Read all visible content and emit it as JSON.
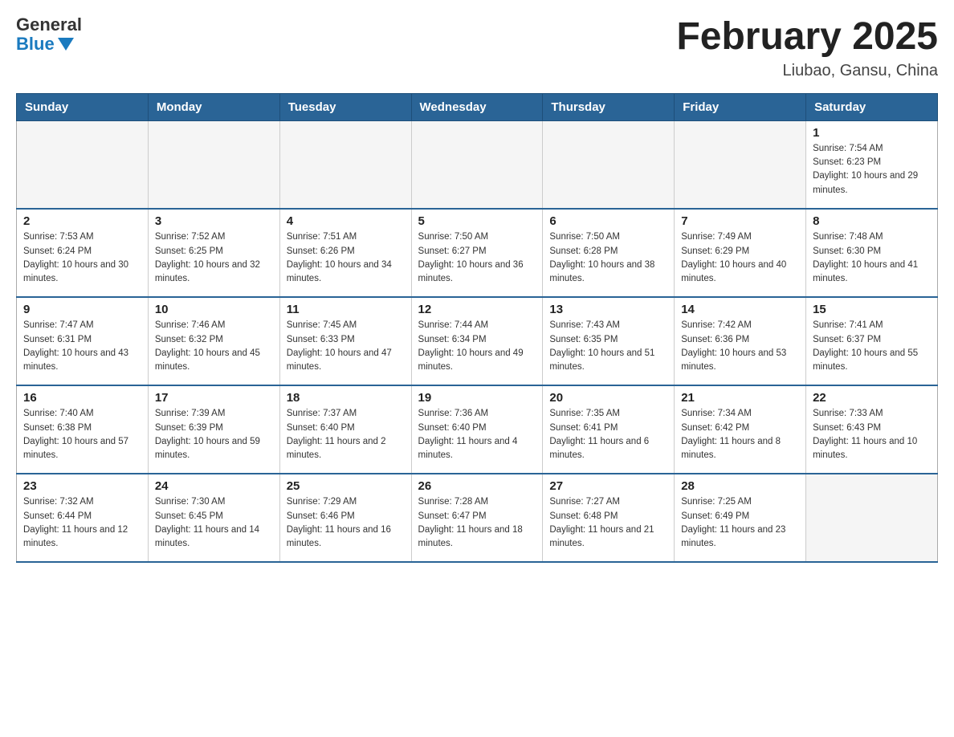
{
  "logo": {
    "general": "General",
    "blue": "Blue"
  },
  "title": "February 2025",
  "subtitle": "Liubao, Gansu, China",
  "days_header": [
    "Sunday",
    "Monday",
    "Tuesday",
    "Wednesday",
    "Thursday",
    "Friday",
    "Saturday"
  ],
  "weeks": [
    [
      {
        "day": "",
        "sunrise": "",
        "sunset": "",
        "daylight": ""
      },
      {
        "day": "",
        "sunrise": "",
        "sunset": "",
        "daylight": ""
      },
      {
        "day": "",
        "sunrise": "",
        "sunset": "",
        "daylight": ""
      },
      {
        "day": "",
        "sunrise": "",
        "sunset": "",
        "daylight": ""
      },
      {
        "day": "",
        "sunrise": "",
        "sunset": "",
        "daylight": ""
      },
      {
        "day": "",
        "sunrise": "",
        "sunset": "",
        "daylight": ""
      },
      {
        "day": "1",
        "sunrise": "Sunrise: 7:54 AM",
        "sunset": "Sunset: 6:23 PM",
        "daylight": "Daylight: 10 hours and 29 minutes."
      }
    ],
    [
      {
        "day": "2",
        "sunrise": "Sunrise: 7:53 AM",
        "sunset": "Sunset: 6:24 PM",
        "daylight": "Daylight: 10 hours and 30 minutes."
      },
      {
        "day": "3",
        "sunrise": "Sunrise: 7:52 AM",
        "sunset": "Sunset: 6:25 PM",
        "daylight": "Daylight: 10 hours and 32 minutes."
      },
      {
        "day": "4",
        "sunrise": "Sunrise: 7:51 AM",
        "sunset": "Sunset: 6:26 PM",
        "daylight": "Daylight: 10 hours and 34 minutes."
      },
      {
        "day": "5",
        "sunrise": "Sunrise: 7:50 AM",
        "sunset": "Sunset: 6:27 PM",
        "daylight": "Daylight: 10 hours and 36 minutes."
      },
      {
        "day": "6",
        "sunrise": "Sunrise: 7:50 AM",
        "sunset": "Sunset: 6:28 PM",
        "daylight": "Daylight: 10 hours and 38 minutes."
      },
      {
        "day": "7",
        "sunrise": "Sunrise: 7:49 AM",
        "sunset": "Sunset: 6:29 PM",
        "daylight": "Daylight: 10 hours and 40 minutes."
      },
      {
        "day": "8",
        "sunrise": "Sunrise: 7:48 AM",
        "sunset": "Sunset: 6:30 PM",
        "daylight": "Daylight: 10 hours and 41 minutes."
      }
    ],
    [
      {
        "day": "9",
        "sunrise": "Sunrise: 7:47 AM",
        "sunset": "Sunset: 6:31 PM",
        "daylight": "Daylight: 10 hours and 43 minutes."
      },
      {
        "day": "10",
        "sunrise": "Sunrise: 7:46 AM",
        "sunset": "Sunset: 6:32 PM",
        "daylight": "Daylight: 10 hours and 45 minutes."
      },
      {
        "day": "11",
        "sunrise": "Sunrise: 7:45 AM",
        "sunset": "Sunset: 6:33 PM",
        "daylight": "Daylight: 10 hours and 47 minutes."
      },
      {
        "day": "12",
        "sunrise": "Sunrise: 7:44 AM",
        "sunset": "Sunset: 6:34 PM",
        "daylight": "Daylight: 10 hours and 49 minutes."
      },
      {
        "day": "13",
        "sunrise": "Sunrise: 7:43 AM",
        "sunset": "Sunset: 6:35 PM",
        "daylight": "Daylight: 10 hours and 51 minutes."
      },
      {
        "day": "14",
        "sunrise": "Sunrise: 7:42 AM",
        "sunset": "Sunset: 6:36 PM",
        "daylight": "Daylight: 10 hours and 53 minutes."
      },
      {
        "day": "15",
        "sunrise": "Sunrise: 7:41 AM",
        "sunset": "Sunset: 6:37 PM",
        "daylight": "Daylight: 10 hours and 55 minutes."
      }
    ],
    [
      {
        "day": "16",
        "sunrise": "Sunrise: 7:40 AM",
        "sunset": "Sunset: 6:38 PM",
        "daylight": "Daylight: 10 hours and 57 minutes."
      },
      {
        "day": "17",
        "sunrise": "Sunrise: 7:39 AM",
        "sunset": "Sunset: 6:39 PM",
        "daylight": "Daylight: 10 hours and 59 minutes."
      },
      {
        "day": "18",
        "sunrise": "Sunrise: 7:37 AM",
        "sunset": "Sunset: 6:40 PM",
        "daylight": "Daylight: 11 hours and 2 minutes."
      },
      {
        "day": "19",
        "sunrise": "Sunrise: 7:36 AM",
        "sunset": "Sunset: 6:40 PM",
        "daylight": "Daylight: 11 hours and 4 minutes."
      },
      {
        "day": "20",
        "sunrise": "Sunrise: 7:35 AM",
        "sunset": "Sunset: 6:41 PM",
        "daylight": "Daylight: 11 hours and 6 minutes."
      },
      {
        "day": "21",
        "sunrise": "Sunrise: 7:34 AM",
        "sunset": "Sunset: 6:42 PM",
        "daylight": "Daylight: 11 hours and 8 minutes."
      },
      {
        "day": "22",
        "sunrise": "Sunrise: 7:33 AM",
        "sunset": "Sunset: 6:43 PM",
        "daylight": "Daylight: 11 hours and 10 minutes."
      }
    ],
    [
      {
        "day": "23",
        "sunrise": "Sunrise: 7:32 AM",
        "sunset": "Sunset: 6:44 PM",
        "daylight": "Daylight: 11 hours and 12 minutes."
      },
      {
        "day": "24",
        "sunrise": "Sunrise: 7:30 AM",
        "sunset": "Sunset: 6:45 PM",
        "daylight": "Daylight: 11 hours and 14 minutes."
      },
      {
        "day": "25",
        "sunrise": "Sunrise: 7:29 AM",
        "sunset": "Sunset: 6:46 PM",
        "daylight": "Daylight: 11 hours and 16 minutes."
      },
      {
        "day": "26",
        "sunrise": "Sunrise: 7:28 AM",
        "sunset": "Sunset: 6:47 PM",
        "daylight": "Daylight: 11 hours and 18 minutes."
      },
      {
        "day": "27",
        "sunrise": "Sunrise: 7:27 AM",
        "sunset": "Sunset: 6:48 PM",
        "daylight": "Daylight: 11 hours and 21 minutes."
      },
      {
        "day": "28",
        "sunrise": "Sunrise: 7:25 AM",
        "sunset": "Sunset: 6:49 PM",
        "daylight": "Daylight: 11 hours and 23 minutes."
      },
      {
        "day": "",
        "sunrise": "",
        "sunset": "",
        "daylight": ""
      }
    ]
  ]
}
